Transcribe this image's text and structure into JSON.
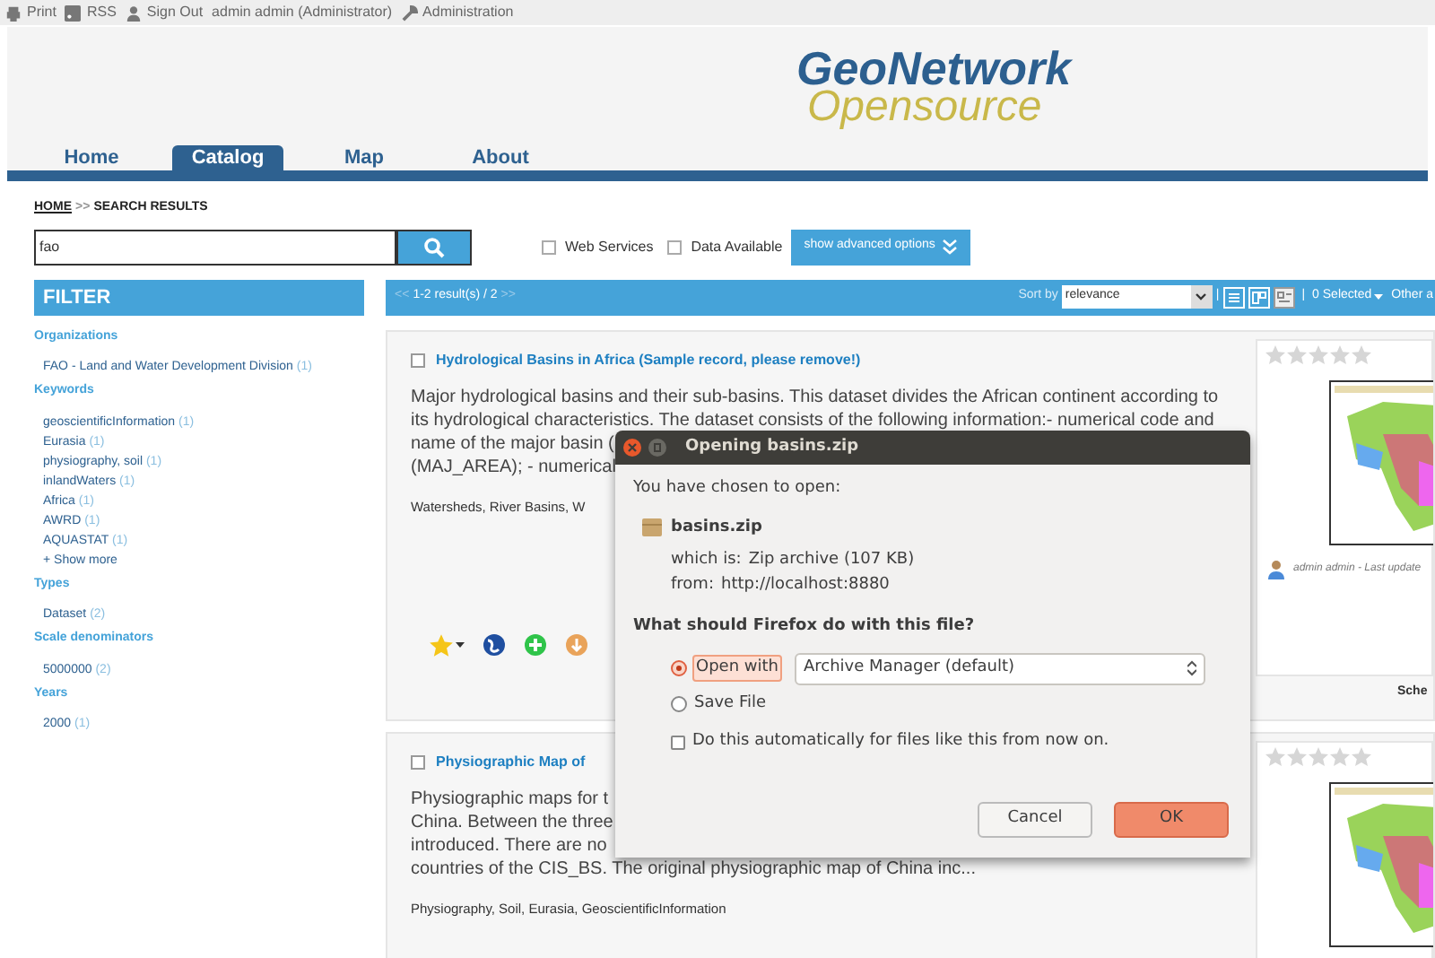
{
  "top_bar": {
    "links": [
      {
        "kind": "print",
        "label": "Print"
      },
      {
        "kind": "rss",
        "label": "RSS"
      },
      {
        "kind": "user",
        "label": "Sign Out"
      },
      {
        "kind": "text",
        "label": "admin admin (Administrator)"
      },
      {
        "kind": "wrench",
        "label": "Administration"
      }
    ]
  },
  "logo": {
    "line_1": "GeoNetwork",
    "line_2": "Opensource"
  },
  "tabs": [
    {
      "label": "Home",
      "selected": false
    },
    {
      "label": "Catalog",
      "selected": true
    },
    {
      "label": "Map",
      "selected": false
    },
    {
      "label": "About",
      "selected": false
    }
  ],
  "breadcrumb": {
    "home": "HOME",
    "separator": ">>",
    "current": "SEARCH RESULTS"
  },
  "search": {
    "value": "fao",
    "options": [
      {
        "label": "Web Services",
        "checked": false
      },
      {
        "label": "Data Available",
        "checked": false
      }
    ],
    "advanced_button": "show advanced options"
  },
  "filter": {
    "title": "FILTER",
    "groups": [
      {
        "title": "Organizations",
        "items": [
          {
            "label": "FAO - Land and Water Development Division",
            "count": "(1)"
          }
        ]
      },
      {
        "title": "Keywords",
        "items": [
          {
            "label": "geoscientificInformation",
            "count": "(1)"
          },
          {
            "label": "Eurasia",
            "count": "(1)"
          },
          {
            "label": "physiography, soil",
            "count": "(1)"
          },
          {
            "label": "inlandWaters",
            "count": "(1)"
          },
          {
            "label": "Africa",
            "count": "(1)"
          },
          {
            "label": "AWRD",
            "count": "(1)"
          },
          {
            "label": "AQUASTAT",
            "count": "(1)"
          }
        ],
        "more": "+ Show more"
      },
      {
        "title": "Types",
        "items": [
          {
            "label": "Dataset",
            "count": "(2)"
          }
        ]
      },
      {
        "title": "Scale denominators",
        "items": [
          {
            "label": "5000000",
            "count": "(2)"
          }
        ]
      },
      {
        "title": "Years",
        "items": [
          {
            "label": "2000",
            "count": "(1)"
          }
        ]
      }
    ]
  },
  "results_bar": {
    "prev": "<<",
    "summary": "1-2 result(s) / 2",
    "next": ">>",
    "sort_label": "Sort by",
    "sort_value": "relevance",
    "views": [
      {
        "kind": "list",
        "selected": false
      },
      {
        "kind": "grid",
        "selected": false
      },
      {
        "kind": "detail",
        "selected": true
      }
    ],
    "separator": "|",
    "selected": "0 Selected",
    "other": "Other a"
  },
  "records": [
    {
      "title": "Hydrological Basins in Africa (Sample record, please remove!)",
      "checked": false,
      "lines": [
        "Major hydrological basins and their sub-basins. This dataset divides the African continent according to",
        "its hydrological characteristics. The dataset consists of the following information:- numerical code and",
        "name of the major basin (",
        "(MAJ_AREA); - numerical"
      ],
      "keywords": "Watersheds, River Basins, W",
      "stars": 0,
      "author": "admin admin - Last update",
      "footer": "Sche",
      "actions": [
        {
          "kind": "favorite"
        },
        {
          "kind": "globe"
        },
        {
          "kind": "add"
        },
        {
          "kind": "download"
        }
      ]
    },
    {
      "title": "Physiographic Map of",
      "checked": false,
      "lines": [
        "Physiographic maps for t",
        "China. Between the three",
        "introduced. There are no",
        "countries of the CIS_BS. The original physiographic map of China inc..."
      ],
      "keywords": "Physiography, Soil, Eurasia, GeoscientificInformation",
      "stars": 0
    }
  ],
  "dialog": {
    "title": "Opening basins.zip",
    "intro": "You have chosen to open:",
    "file_name": "basins.zip",
    "which_label": "which is:",
    "which_value": "Zip archive (107 KB)",
    "from_label": "from:",
    "from_value": "http://localhost:8880",
    "question": "What should Firefox do with this file?",
    "choices": [
      {
        "label": "Open with",
        "selected": true
      },
      {
        "label": "Save File",
        "selected": false
      }
    ],
    "application": "Archive Manager (default)",
    "remember": {
      "label": "Do this automatically for files like this from now on.",
      "checked": false
    },
    "buttons": [
      {
        "label": "Cancel",
        "kind": "secondary"
      },
      {
        "label": "OK",
        "kind": "primary"
      }
    ]
  }
}
